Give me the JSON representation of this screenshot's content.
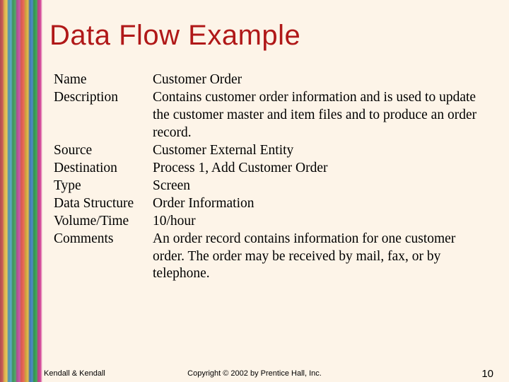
{
  "title": "Data Flow Example",
  "fields": [
    {
      "label": "Name",
      "value": "Customer Order"
    },
    {
      "label": "Description",
      "value": "Contains customer order information and is used to update the customer master and item files and to produce an order record."
    },
    {
      "label": "Source",
      "value": "Customer External Entity"
    },
    {
      "label": "Destination",
      "value": "Process 1, Add Customer Order"
    },
    {
      "label": "Type",
      "value": "Screen"
    },
    {
      "label": "Data Structure",
      "value": "Order Information"
    },
    {
      "label": "Volume/Time",
      "value": "10/hour"
    },
    {
      "label": "Comments",
      "value": "An order record contains information for one customer order.  The order may be received by mail, fax, or by telephone."
    }
  ],
  "footer": {
    "left": "Kendall & Kendall",
    "center": "Copyright © 2002 by Prentice Hall, Inc.",
    "right": "10"
  }
}
